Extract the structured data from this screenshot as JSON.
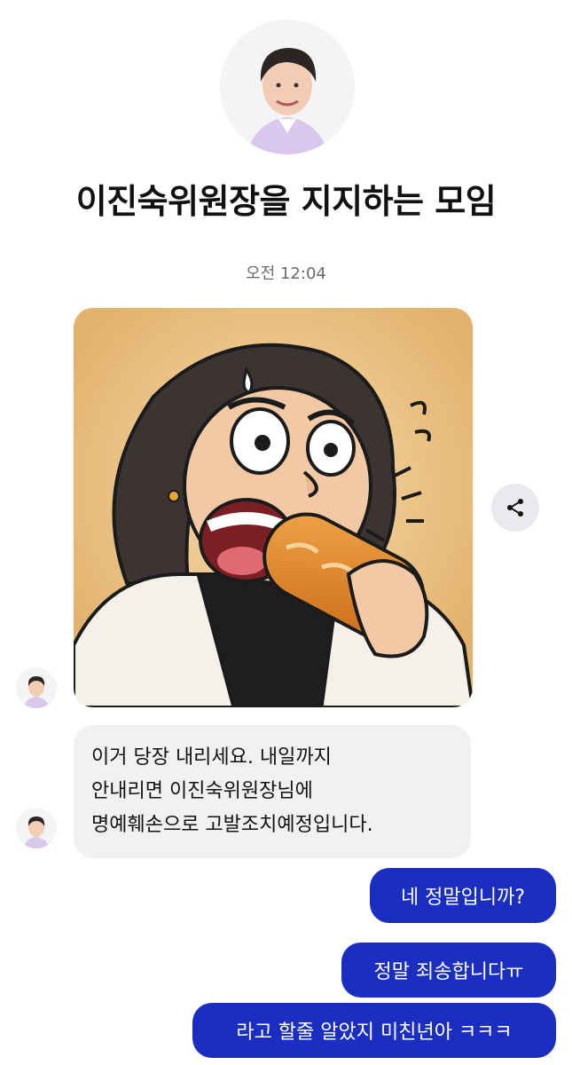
{
  "chat": {
    "title": "이진숙위원장을 지지하는 모임",
    "timestamp": "오전 12:04"
  },
  "messages": {
    "incoming_text": "이거 당장 내리세요. 내일까지\n안내리면 이진숙위원장님에\n명예훼손으로 고발조치예정입니다.",
    "outgoing": [
      "네 정말입니까?",
      "정말 죄송합니다ㅠ",
      "라고 할줄 알았지 미친년아 ㅋㅋㅋ"
    ]
  },
  "icons": {
    "share": "share-icon",
    "avatar": "avatar"
  },
  "colors": {
    "outgoing_bubble": "#1b2ec2",
    "incoming_bubble": "#f1f1f4",
    "share_button": "#e9eaee"
  }
}
